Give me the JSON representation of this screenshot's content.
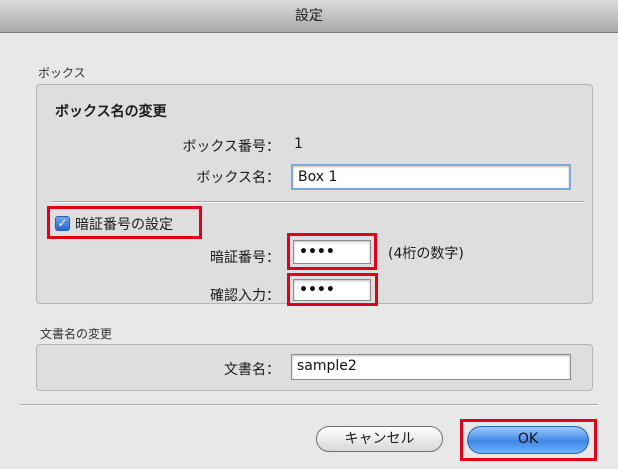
{
  "window": {
    "title": "設定"
  },
  "box_section": {
    "label": "ボックス",
    "rename_heading": "ボックス名の変更",
    "number_label": "ボックス番号：",
    "number_value": "1",
    "name_label": "ボックス名：",
    "name_value": "Box 1",
    "pin_checkbox_label": "暗証番号の設定",
    "pin_checkbox_checked": true,
    "pin_label": "暗証番号：",
    "pin_value": "••••",
    "pin_hint": "(4桁の数字)",
    "confirm_label": "確認入力：",
    "confirm_value": "••••"
  },
  "doc_section": {
    "label": "文書名の変更",
    "name_label": "文書名：",
    "name_value": "sample2"
  },
  "buttons": {
    "cancel": "キャンセル",
    "ok": "OK"
  },
  "colors": {
    "highlight": "#e1001a",
    "accent": "#3f89e6"
  }
}
